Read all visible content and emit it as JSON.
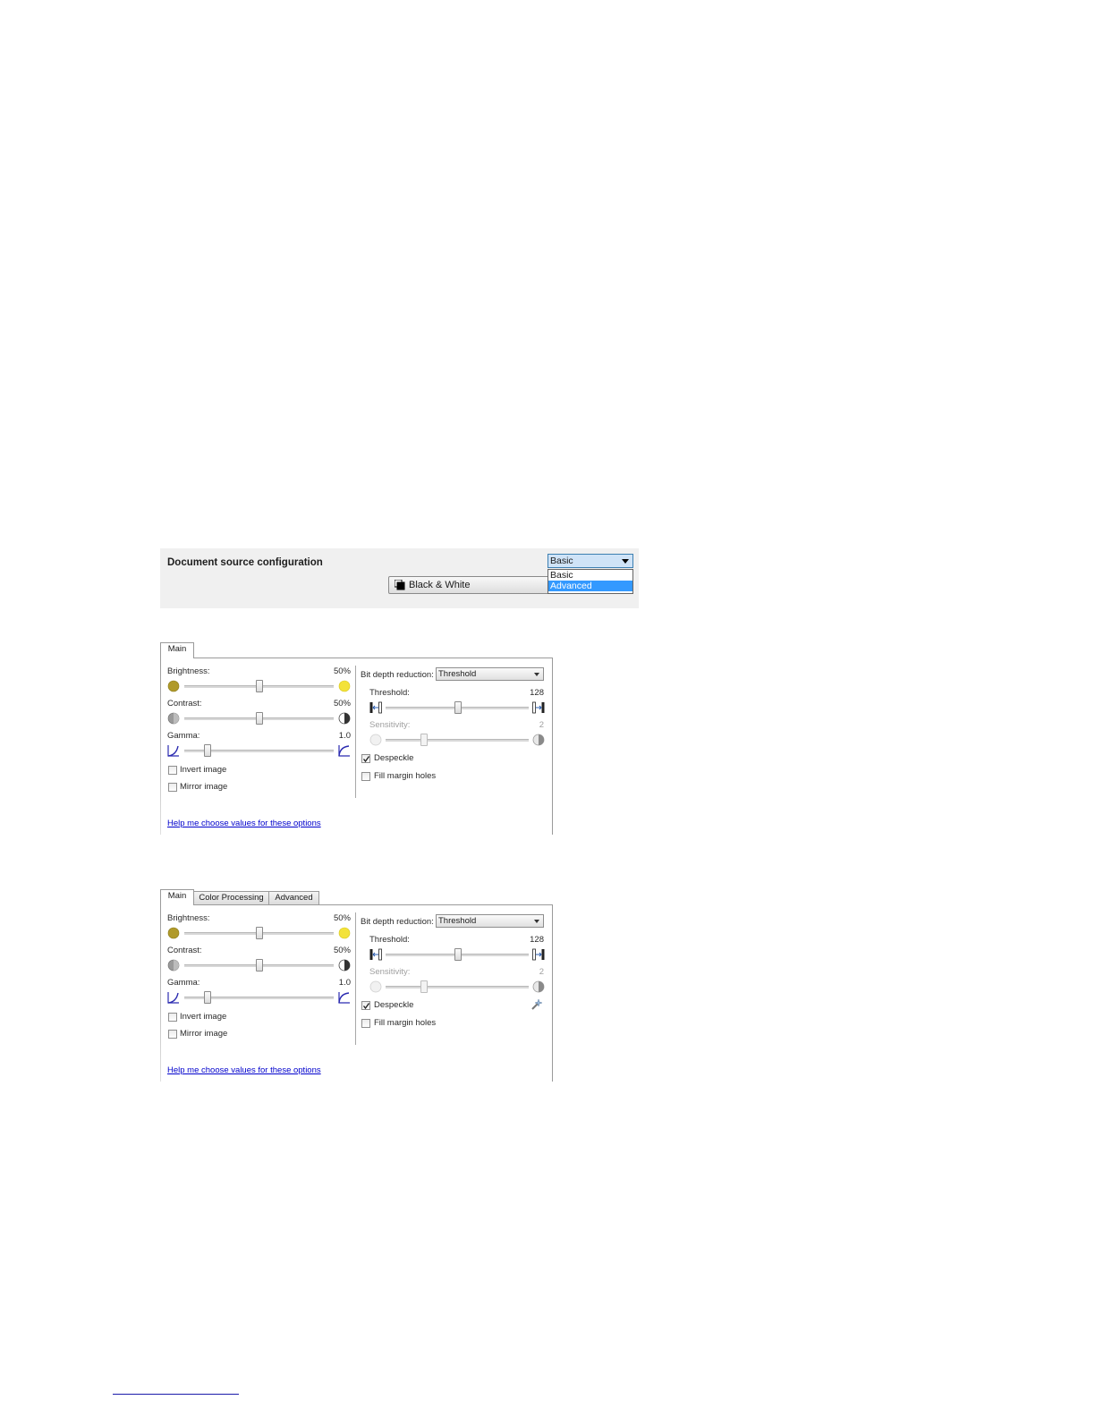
{
  "config": {
    "title": "Document source configuration",
    "mode_selected": "Basic",
    "mode_options": [
      "Basic",
      "Advanced"
    ],
    "profile_button": "Black & White"
  },
  "panel_basic": {
    "tabs": [
      "Main"
    ],
    "brightness_label": "Brightness:",
    "brightness_value": "50%",
    "brightness_level": 50,
    "contrast_label": "Contrast:",
    "contrast_value": "50%",
    "contrast_level": 50,
    "gamma_label": "Gamma:",
    "gamma_value": "1.0",
    "invert_label": "Invert image",
    "invert_checked": false,
    "mirror_label": "Mirror image",
    "mirror_checked": false,
    "bitdepth_label": "Bit depth reduction:",
    "bitdepth_value": "Threshold",
    "threshold_label": "Threshold:",
    "threshold_value": "128",
    "sensitivity_label": "Sensitivity:",
    "sensitivity_value": "2",
    "despeckle_label": "Despeckle",
    "despeckle_checked": true,
    "fill_label": "Fill margin holes",
    "fill_checked": false,
    "help_link": "Help me choose values for these options"
  },
  "panel_advanced": {
    "tabs": [
      "Main",
      "Color Processing",
      "Advanced"
    ],
    "brightness_label": "Brightness:",
    "brightness_value": "50%",
    "brightness_level": 50,
    "contrast_label": "Contrast:",
    "contrast_value": "50%",
    "contrast_level": 50,
    "gamma_label": "Gamma:",
    "gamma_value": "1.0",
    "invert_label": "Invert image",
    "invert_checked": false,
    "mirror_label": "Mirror image",
    "mirror_checked": false,
    "bitdepth_label": "Bit depth reduction:",
    "bitdepth_value": "Threshold",
    "threshold_label": "Threshold:",
    "threshold_value": "128",
    "sensitivity_label": "Sensitivity:",
    "sensitivity_value": "2",
    "despeckle_label": "Despeckle",
    "despeckle_checked": true,
    "fill_label": "Fill margin holes",
    "fill_checked": false,
    "help_link": "Help me choose values for these options"
  },
  "colors": {
    "accent": "#3399ff",
    "link": "#0000cc",
    "brightness_low": "#b09a2a",
    "brightness_high": "#f3e23a",
    "gamma_icon": "#2b2bb0"
  }
}
